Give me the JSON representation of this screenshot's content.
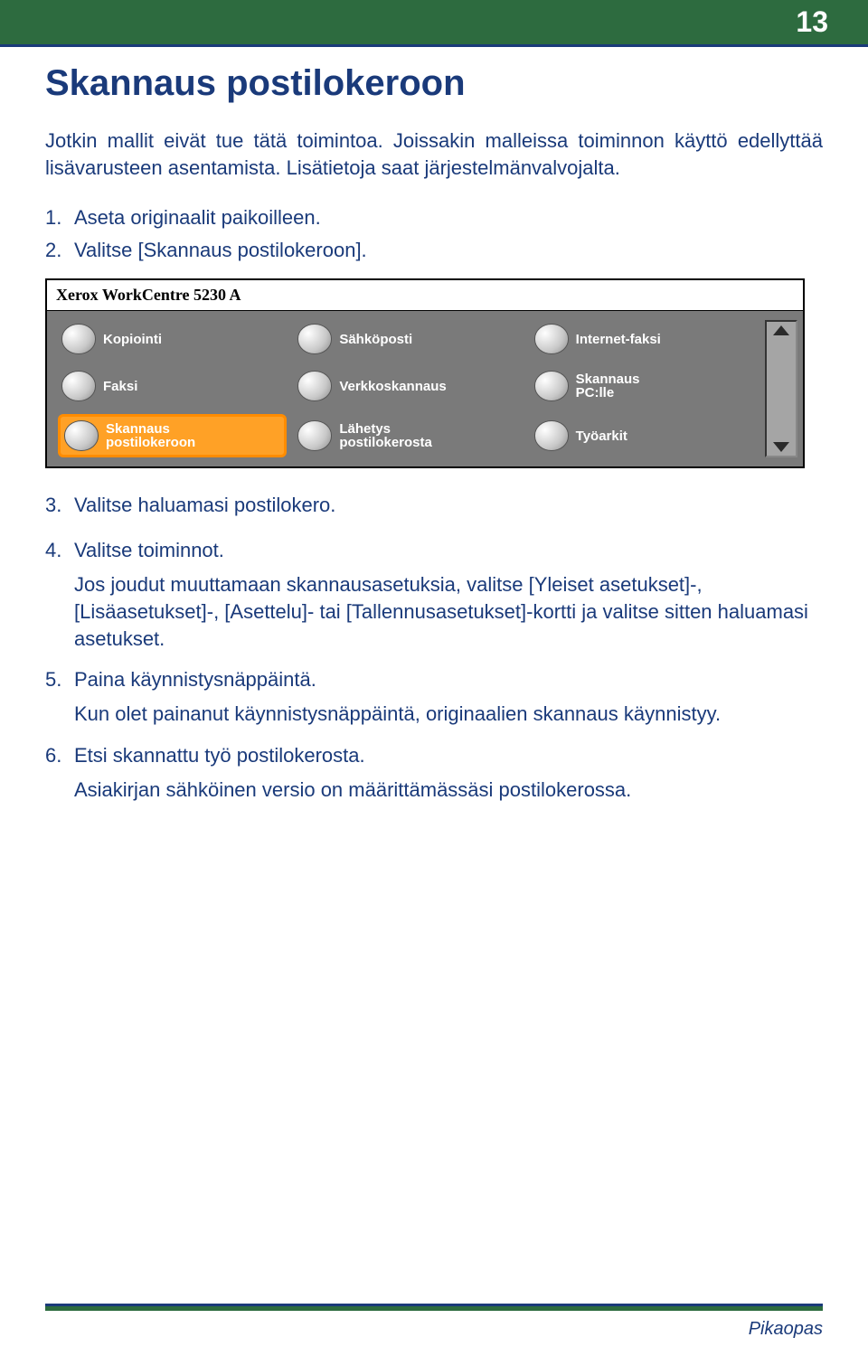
{
  "page_number": "13",
  "title": "Skannaus postilokeroon",
  "intro": "Jotkin mallit eivät tue tätä toimintoa. Joissakin malleissa toiminnon käyttö edellyttää lisävarusteen asentamista. Lisätietoja saat järjestelmänvalvojalta.",
  "steps": {
    "s1": "Aseta originaalit paikoilleen.",
    "s2": "Valitse [Skannaus postilokeroon].",
    "s3": "Valitse haluamasi postilokero.",
    "s4": "Valitse toiminnot.",
    "s4_note": "Jos joudut muuttamaan skannausasetuksia, valitse [Yleiset asetukset]-, [Lisäasetukset]-, [Asettelu]- tai [Tallennusasetukset]-kortti ja valitse sitten haluamasi asetukset.",
    "s5": "Paina käynnistysnäppäintä.",
    "s5_note": "Kun olet painanut käynnistysnäppäintä, originaalien skannaus käynnistyy.",
    "s6": "Etsi skannattu työ postilokerosta.",
    "s6_note": "Asiakirjan sähköinen versio on määrittämässäsi postilokerossa."
  },
  "screenshot": {
    "window_title": "Xerox WorkCentre 5230 A",
    "items": [
      {
        "label": "Kopiointi",
        "icon": "copy-icon"
      },
      {
        "label": "Sähköposti",
        "icon": "email-icon"
      },
      {
        "label": "Internet-faksi",
        "icon": "internet-fax-icon"
      },
      {
        "label": "Faksi",
        "icon": "fax-icon"
      },
      {
        "label": "Verkkoskannaus",
        "icon": "network-scan-icon"
      },
      {
        "label": "Skannaus\nPC:lle",
        "icon": "scan-pc-icon"
      },
      {
        "label": "Skannaus\npostilokeroon",
        "icon": "scan-mailbox-icon",
        "highlight": true
      },
      {
        "label": "Lähetys\npostilokerosta",
        "icon": "send-mailbox-icon"
      },
      {
        "label": "Työarkit",
        "icon": "jobsheets-icon"
      }
    ]
  },
  "footer": "Pikaopas",
  "colors": {
    "accent": "#2d6b3f",
    "rule": "#1a3a7a",
    "highlight": "#ffa126"
  }
}
